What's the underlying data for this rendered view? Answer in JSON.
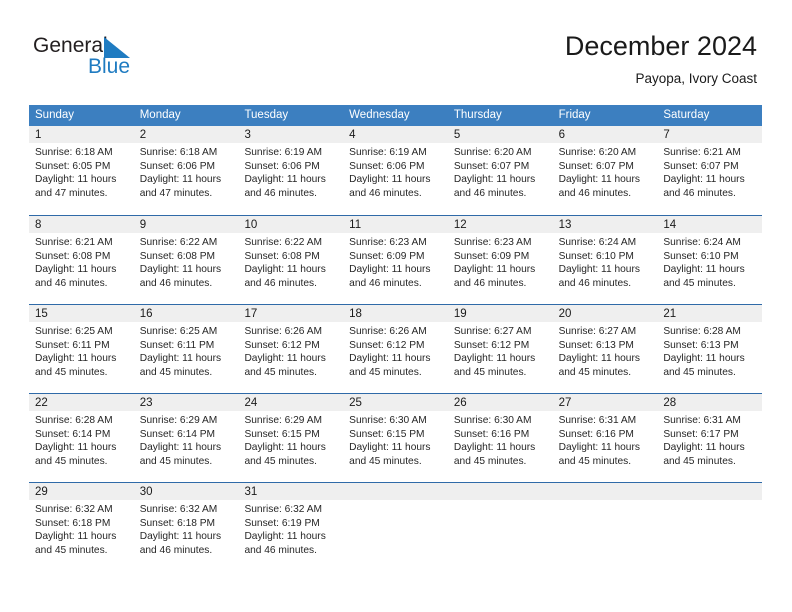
{
  "brand": {
    "name_part1": "General",
    "name_part2": "Blue",
    "logo_icon": "triangle-mark",
    "accent_color": "#1f7bc1"
  },
  "header": {
    "title": "December 2024",
    "location": "Payopa, Ivory Coast"
  },
  "theme": {
    "header_bg": "#3c7fc0",
    "row_divider": "#2f6aa8",
    "day_band": "#efefef",
    "text": "#262626"
  },
  "calendar": {
    "weekday_headers": [
      "Sunday",
      "Monday",
      "Tuesday",
      "Wednesday",
      "Thursday",
      "Friday",
      "Saturday"
    ],
    "weeks": [
      {
        "days": [
          {
            "num": "1",
            "sunrise": "Sunrise: 6:18 AM",
            "sunset": "Sunset: 6:05 PM",
            "daylight1": "Daylight: 11 hours",
            "daylight2": "and 47 minutes."
          },
          {
            "num": "2",
            "sunrise": "Sunrise: 6:18 AM",
            "sunset": "Sunset: 6:06 PM",
            "daylight1": "Daylight: 11 hours",
            "daylight2": "and 47 minutes."
          },
          {
            "num": "3",
            "sunrise": "Sunrise: 6:19 AM",
            "sunset": "Sunset: 6:06 PM",
            "daylight1": "Daylight: 11 hours",
            "daylight2": "and 46 minutes."
          },
          {
            "num": "4",
            "sunrise": "Sunrise: 6:19 AM",
            "sunset": "Sunset: 6:06 PM",
            "daylight1": "Daylight: 11 hours",
            "daylight2": "and 46 minutes."
          },
          {
            "num": "5",
            "sunrise": "Sunrise: 6:20 AM",
            "sunset": "Sunset: 6:07 PM",
            "daylight1": "Daylight: 11 hours",
            "daylight2": "and 46 minutes."
          },
          {
            "num": "6",
            "sunrise": "Sunrise: 6:20 AM",
            "sunset": "Sunset: 6:07 PM",
            "daylight1": "Daylight: 11 hours",
            "daylight2": "and 46 minutes."
          },
          {
            "num": "7",
            "sunrise": "Sunrise: 6:21 AM",
            "sunset": "Sunset: 6:07 PM",
            "daylight1": "Daylight: 11 hours",
            "daylight2": "and 46 minutes."
          }
        ]
      },
      {
        "days": [
          {
            "num": "8",
            "sunrise": "Sunrise: 6:21 AM",
            "sunset": "Sunset: 6:08 PM",
            "daylight1": "Daylight: 11 hours",
            "daylight2": "and 46 minutes."
          },
          {
            "num": "9",
            "sunrise": "Sunrise: 6:22 AM",
            "sunset": "Sunset: 6:08 PM",
            "daylight1": "Daylight: 11 hours",
            "daylight2": "and 46 minutes."
          },
          {
            "num": "10",
            "sunrise": "Sunrise: 6:22 AM",
            "sunset": "Sunset: 6:08 PM",
            "daylight1": "Daylight: 11 hours",
            "daylight2": "and 46 minutes."
          },
          {
            "num": "11",
            "sunrise": "Sunrise: 6:23 AM",
            "sunset": "Sunset: 6:09 PM",
            "daylight1": "Daylight: 11 hours",
            "daylight2": "and 46 minutes."
          },
          {
            "num": "12",
            "sunrise": "Sunrise: 6:23 AM",
            "sunset": "Sunset: 6:09 PM",
            "daylight1": "Daylight: 11 hours",
            "daylight2": "and 46 minutes."
          },
          {
            "num": "13",
            "sunrise": "Sunrise: 6:24 AM",
            "sunset": "Sunset: 6:10 PM",
            "daylight1": "Daylight: 11 hours",
            "daylight2": "and 46 minutes."
          },
          {
            "num": "14",
            "sunrise": "Sunrise: 6:24 AM",
            "sunset": "Sunset: 6:10 PM",
            "daylight1": "Daylight: 11 hours",
            "daylight2": "and 45 minutes."
          }
        ]
      },
      {
        "days": [
          {
            "num": "15",
            "sunrise": "Sunrise: 6:25 AM",
            "sunset": "Sunset: 6:11 PM",
            "daylight1": "Daylight: 11 hours",
            "daylight2": "and 45 minutes."
          },
          {
            "num": "16",
            "sunrise": "Sunrise: 6:25 AM",
            "sunset": "Sunset: 6:11 PM",
            "daylight1": "Daylight: 11 hours",
            "daylight2": "and 45 minutes."
          },
          {
            "num": "17",
            "sunrise": "Sunrise: 6:26 AM",
            "sunset": "Sunset: 6:12 PM",
            "daylight1": "Daylight: 11 hours",
            "daylight2": "and 45 minutes."
          },
          {
            "num": "18",
            "sunrise": "Sunrise: 6:26 AM",
            "sunset": "Sunset: 6:12 PM",
            "daylight1": "Daylight: 11 hours",
            "daylight2": "and 45 minutes."
          },
          {
            "num": "19",
            "sunrise": "Sunrise: 6:27 AM",
            "sunset": "Sunset: 6:12 PM",
            "daylight1": "Daylight: 11 hours",
            "daylight2": "and 45 minutes."
          },
          {
            "num": "20",
            "sunrise": "Sunrise: 6:27 AM",
            "sunset": "Sunset: 6:13 PM",
            "daylight1": "Daylight: 11 hours",
            "daylight2": "and 45 minutes."
          },
          {
            "num": "21",
            "sunrise": "Sunrise: 6:28 AM",
            "sunset": "Sunset: 6:13 PM",
            "daylight1": "Daylight: 11 hours",
            "daylight2": "and 45 minutes."
          }
        ]
      },
      {
        "days": [
          {
            "num": "22",
            "sunrise": "Sunrise: 6:28 AM",
            "sunset": "Sunset: 6:14 PM",
            "daylight1": "Daylight: 11 hours",
            "daylight2": "and 45 minutes."
          },
          {
            "num": "23",
            "sunrise": "Sunrise: 6:29 AM",
            "sunset": "Sunset: 6:14 PM",
            "daylight1": "Daylight: 11 hours",
            "daylight2": "and 45 minutes."
          },
          {
            "num": "24",
            "sunrise": "Sunrise: 6:29 AM",
            "sunset": "Sunset: 6:15 PM",
            "daylight1": "Daylight: 11 hours",
            "daylight2": "and 45 minutes."
          },
          {
            "num": "25",
            "sunrise": "Sunrise: 6:30 AM",
            "sunset": "Sunset: 6:15 PM",
            "daylight1": "Daylight: 11 hours",
            "daylight2": "and 45 minutes."
          },
          {
            "num": "26",
            "sunrise": "Sunrise: 6:30 AM",
            "sunset": "Sunset: 6:16 PM",
            "daylight1": "Daylight: 11 hours",
            "daylight2": "and 45 minutes."
          },
          {
            "num": "27",
            "sunrise": "Sunrise: 6:31 AM",
            "sunset": "Sunset: 6:16 PM",
            "daylight1": "Daylight: 11 hours",
            "daylight2": "and 45 minutes."
          },
          {
            "num": "28",
            "sunrise": "Sunrise: 6:31 AM",
            "sunset": "Sunset: 6:17 PM",
            "daylight1": "Daylight: 11 hours",
            "daylight2": "and 45 minutes."
          }
        ]
      },
      {
        "days": [
          {
            "num": "29",
            "sunrise": "Sunrise: 6:32 AM",
            "sunset": "Sunset: 6:18 PM",
            "daylight1": "Daylight: 11 hours",
            "daylight2": "and 45 minutes."
          },
          {
            "num": "30",
            "sunrise": "Sunrise: 6:32 AM",
            "sunset": "Sunset: 6:18 PM",
            "daylight1": "Daylight: 11 hours",
            "daylight2": "and 46 minutes."
          },
          {
            "num": "31",
            "sunrise": "Sunrise: 6:32 AM",
            "sunset": "Sunset: 6:19 PM",
            "daylight1": "Daylight: 11 hours",
            "daylight2": "and 46 minutes."
          },
          {
            "num": "",
            "sunrise": "",
            "sunset": "",
            "daylight1": "",
            "daylight2": ""
          },
          {
            "num": "",
            "sunrise": "",
            "sunset": "",
            "daylight1": "",
            "daylight2": ""
          },
          {
            "num": "",
            "sunrise": "",
            "sunset": "",
            "daylight1": "",
            "daylight2": ""
          },
          {
            "num": "",
            "sunrise": "",
            "sunset": "",
            "daylight1": "",
            "daylight2": ""
          }
        ]
      }
    ]
  }
}
